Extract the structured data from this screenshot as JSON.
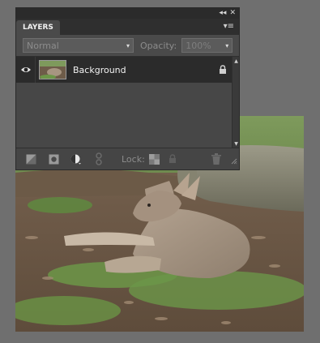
{
  "panel": {
    "topbar": {
      "collapse_glyph": "◂◂",
      "close_glyph": "✕"
    },
    "tab_label": "LAYERS",
    "menu_glyph": "▾≡",
    "blend_mode": {
      "value": "Normal",
      "caret": "▾"
    },
    "opacity": {
      "label": "Opacity:",
      "value": "100%",
      "caret": "▾"
    },
    "layers": [
      {
        "name": "Background",
        "visible": true,
        "locked": true
      }
    ],
    "scroll": {
      "up": "▲",
      "down": "▼"
    },
    "bottombar": {
      "lock_label": "Lock:"
    }
  },
  "colors": {
    "panel_bg": "#3e3e3e",
    "row_selected": "#2b2b2b",
    "canvas_bg": "#6f6f6f"
  },
  "icons": [
    "eye-icon",
    "lock-icon",
    "new-layer-icon",
    "layer-mask-icon",
    "adjustment-layer-icon",
    "link-icon",
    "lock-transparency-icon",
    "lock-all-icon",
    "trash-icon",
    "resize-grip-icon"
  ]
}
